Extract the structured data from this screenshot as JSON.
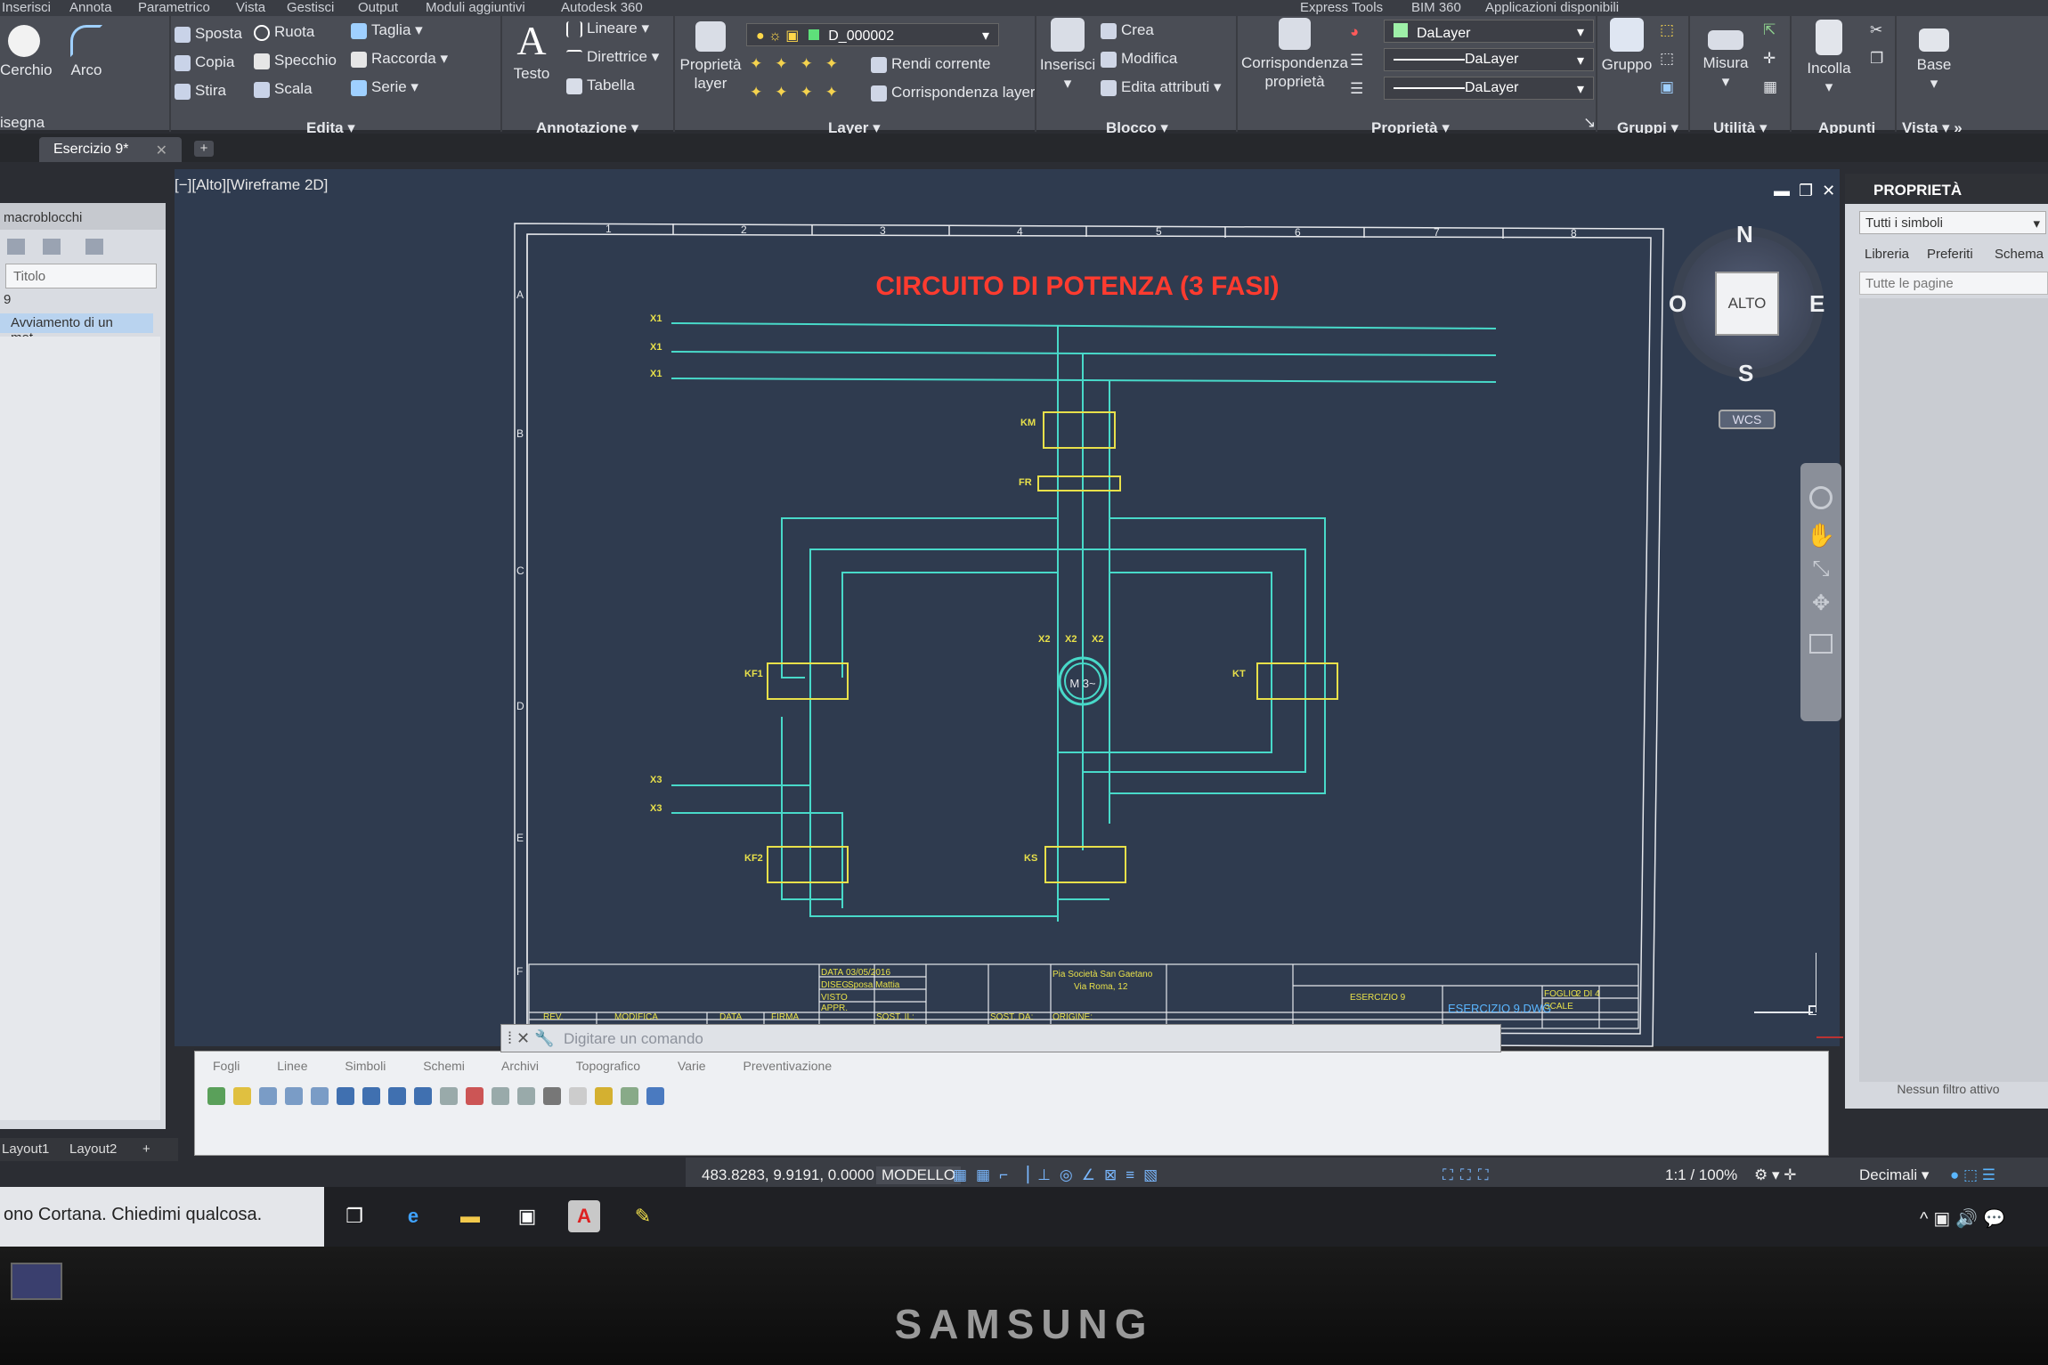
{
  "menubar": {
    "items": [
      "Inserisci",
      "Annota",
      "Parametrico",
      "Vista",
      "Gestisci",
      "Output",
      "Moduli aggiuntivi",
      "Autodesk 360",
      "Express Tools",
      "BIM 360",
      "Applicazioni disponibili"
    ]
  },
  "ribbon": {
    "draw": {
      "circle": "Cerchio",
      "arc": "Arco",
      "group": "isegna"
    },
    "modify": {
      "move": "Sposta",
      "rotate": "Ruota",
      "trim": "Taglia",
      "copy": "Copia",
      "mirror": "Specchio",
      "fillet": "Raccorda",
      "stretch": "Stira",
      "scale": "Scala",
      "array": "Serie",
      "group": "Edita"
    },
    "annotation": {
      "text": "Testo",
      "linear": "Lineare",
      "leader": "Direttrice",
      "table": "Tabella",
      "group": "Annotazione"
    },
    "layers": {
      "current_layer": "D_000002",
      "properties": "Proprietà layer",
      "make_current": "Rendi corrente",
      "match_layer": "Corrispondenza layer",
      "group": "Layer"
    },
    "block": {
      "insert": "Inserisci",
      "create": "Crea",
      "edit": "Modifica",
      "edit_attributes": "Edita attributi",
      "group": "Blocco"
    },
    "properties": {
      "match": "Corrispondenza proprietà",
      "color": "DaLayer",
      "linetype": "DaLayer",
      "lineweight": "DaLayer",
      "group": "Proprietà"
    },
    "groups": {
      "group_btn": "Gruppo",
      "group": "Gruppi"
    },
    "utilities": {
      "measure": "Misura",
      "group": "Utilità"
    },
    "clipboard": {
      "paste": "Incolla",
      "group": "Appunti"
    },
    "view": {
      "base": "Base",
      "group": "Vista"
    }
  },
  "file_tab": {
    "name": "Esercizio 9*"
  },
  "left_panel": {
    "header": "macroblocchi",
    "title_placeholder": "Titolo",
    "number": "9",
    "item": "Avviamento di un mot..."
  },
  "viewport": {
    "label": "[−][Alto][Wireframe 2D]"
  },
  "viewcube": {
    "north": "N",
    "south": "S",
    "east": "E",
    "west": "O",
    "face": "ALTO",
    "ucs": "WCS"
  },
  "drawing": {
    "title": "CIRCUITO DI POTENZA (3 FASI)",
    "col_labels": [
      "1",
      "2",
      "3",
      "4",
      "5",
      "6",
      "7",
      "8"
    ],
    "row_labels": [
      "A",
      "B",
      "C",
      "D",
      "E",
      "F"
    ],
    "labels": {
      "x1": "X1",
      "km": "KM",
      "fr": "FR",
      "kf1": "KF1",
      "kt": "KT",
      "kf2": "KF2",
      "ks": "KS",
      "x3": "X3",
      "x2": "X2",
      "motor": "M 3~"
    },
    "title_block": {
      "date_label": "DATA",
      "date": "03/05/2016",
      "drawn_label": "DISEG.",
      "drawn": "Sposa Mattia",
      "checked_label": "VISTO",
      "approved_label": "APPR.",
      "company": "Pia Società San Gaetano",
      "address": "Via Roma, 12",
      "exercise": "ESERCIZIO 9",
      "file": "ESERCIZIO 9.DWG",
      "sheet_label": "FOGLIO",
      "sheet": "2 DI 4",
      "scale_label": "SCALE",
      "rev": "REV.",
      "modify": "MODIFICA",
      "data2": "DATA",
      "firm": "FIRMA",
      "sost_il": "SOST. IL:",
      "sost_da": "SOST. DA:",
      "origin": "ORIGINE:"
    }
  },
  "properties_panel": {
    "title": "PROPRIETÀ",
    "filter": "Tutti i simboli",
    "tabs": [
      "Libreria",
      "Preferiti",
      "Schema"
    ],
    "pages": "Tutte le pagine",
    "footer": "Nessun filtro attivo"
  },
  "palette": {
    "tabs": [
      "Fogli",
      "Linee",
      "Simboli",
      "Schemi",
      "Archivi",
      "Topografico",
      "Varie",
      "Preventivazione"
    ]
  },
  "command_line": {
    "placeholder": "Digitare un comando"
  },
  "layout_tabs": [
    "Layout1",
    "Layout2"
  ],
  "status": {
    "coords": "483.8283, 9.9191, 0.0000",
    "space": "MODELLO",
    "scale": "1:1 / 100%",
    "units": "Decimali"
  },
  "taskbar": {
    "cortana": "ono Cortana. Chiedimi qualcosa."
  },
  "monitor": {
    "brand": "SAMSUNG"
  },
  "colors": {
    "ribbon": "#4a4d55",
    "viewport": "#2f3b4f",
    "wire": "#48d9c9",
    "symbol": "#e8e04a",
    "title": "#ff3b2f"
  }
}
